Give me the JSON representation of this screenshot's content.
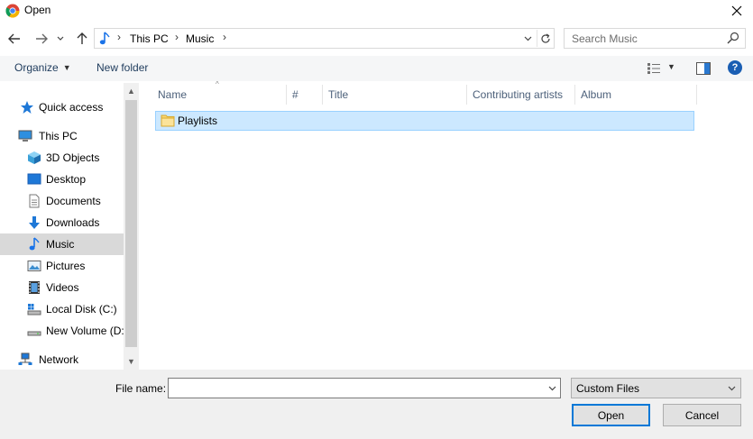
{
  "window": {
    "title": "Open"
  },
  "address": {
    "crumbs": [
      "This PC",
      "Music"
    ]
  },
  "search": {
    "placeholder": "Search Music"
  },
  "toolbar": {
    "organize_label": "Organize",
    "new_folder_label": "New folder"
  },
  "nav": {
    "items": [
      {
        "label": "Quick access",
        "icon": "star-icon"
      },
      {
        "label": "This PC",
        "icon": "computer-icon"
      },
      {
        "label": "3D Objects",
        "icon": "cube-icon"
      },
      {
        "label": "Desktop",
        "icon": "desktop-icon"
      },
      {
        "label": "Documents",
        "icon": "document-icon"
      },
      {
        "label": "Downloads",
        "icon": "download-icon"
      },
      {
        "label": "Music",
        "icon": "music-icon",
        "selected": true
      },
      {
        "label": "Pictures",
        "icon": "picture-icon"
      },
      {
        "label": "Videos",
        "icon": "film-icon"
      },
      {
        "label": "Local Disk (C:)",
        "icon": "drive-icon"
      },
      {
        "label": "New Volume (D:",
        "icon": "drive-icon"
      },
      {
        "label": "Network",
        "icon": "network-icon"
      }
    ]
  },
  "columns": [
    "Name",
    "#",
    "Title",
    "Contributing artists",
    "Album"
  ],
  "files": [
    {
      "name": "Playlists",
      "type": "folder",
      "selected": true
    }
  ],
  "bottom": {
    "file_name_label": "File name:",
    "file_name_value": "",
    "filter_value": "Custom Files",
    "open_label": "Open",
    "cancel_label": "Cancel"
  },
  "colors": {
    "accent": "#0078d7",
    "selection": "#cce8ff",
    "nav_selected": "#d9d9d9"
  }
}
